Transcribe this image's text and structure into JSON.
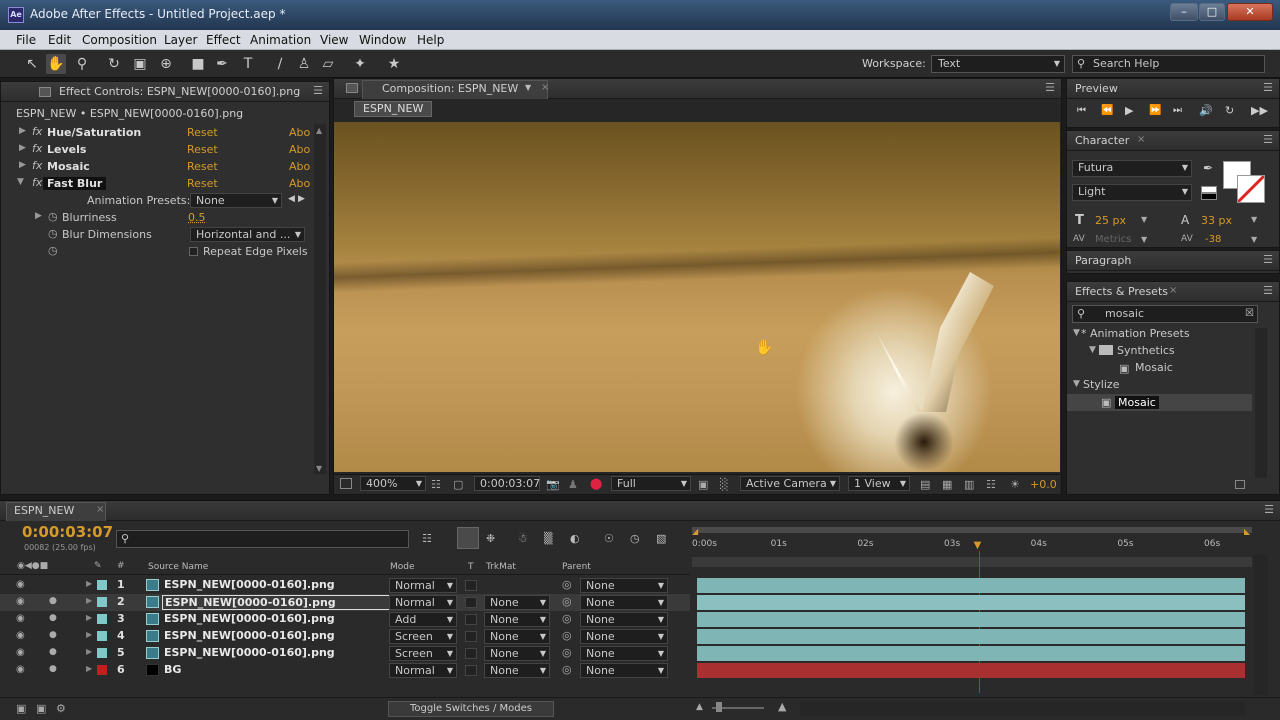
{
  "window": {
    "title": "Adobe After Effects - Untitled Project.aep *",
    "app_icon": "Ae"
  },
  "menu": [
    "File",
    "Edit",
    "Composition",
    "Layer",
    "Effect",
    "Animation",
    "View",
    "Window",
    "Help"
  ],
  "toolbar": {
    "workspace_label": "Workspace:",
    "workspace_value": "Text",
    "search_placeholder": "Search Help"
  },
  "effect_controls": {
    "tab": "Effect Controls: ESPN_NEW[0000-0160].png",
    "breadcrumb": "ESPN_NEW • ESPN_NEW[0000-0160].png",
    "effects": [
      {
        "name": "Hue/Saturation",
        "reset": "Reset",
        "about": "Abo"
      },
      {
        "name": "Levels",
        "reset": "Reset",
        "about": "Abo"
      },
      {
        "name": "Mosaic",
        "reset": "Reset",
        "about": "Abo"
      },
      {
        "name": "Fast Blur",
        "reset": "Reset",
        "about": "Abo"
      }
    ],
    "animation_presets_label": "Animation Presets:",
    "animation_presets_value": "None",
    "blurriness_label": "Blurriness",
    "blurriness_value": "0.5",
    "blur_dimensions_label": "Blur Dimensions",
    "blur_dimensions_value": "Horizontal and ...",
    "repeat_edge_label": "Repeat Edge Pixels"
  },
  "composition": {
    "tab": "Composition: ESPN_NEW",
    "comp_name": "ESPN_NEW",
    "zoom": "400%",
    "timecode": "0:00:03:07",
    "resolution": "Full",
    "camera": "Active Camera",
    "views": "1 View",
    "exposure": "+0.0"
  },
  "preview": {
    "tab": "Preview"
  },
  "character": {
    "tab": "Character",
    "font": "Futura",
    "style": "Light",
    "size": "25 px",
    "leading": "33 px",
    "kerning": "Metrics",
    "tracking": "-38"
  },
  "paragraph": {
    "tab": "Paragraph"
  },
  "effects_presets": {
    "tab": "Effects & Presets",
    "search_value": "mosaic",
    "tree": [
      {
        "label": "* Animation Presets",
        "level": 0
      },
      {
        "label": "Synthetics",
        "level": 1
      },
      {
        "label": "Mosaic",
        "level": 2
      },
      {
        "label": "Stylize",
        "level": 0
      },
      {
        "label": "Mosaic",
        "level": 1
      }
    ]
  },
  "timeline": {
    "tab": "ESPN_NEW",
    "timecode": "0:00:03:07",
    "frame_info": "00082 (25.00 fps)",
    "columns": {
      "source_name": "Source Name",
      "mode": "Mode",
      "t": "T",
      "trkmat": "TrkMat",
      "parent": "Parent"
    },
    "ruler": [
      "0:00s",
      "01s",
      "02s",
      "03s",
      "04s",
      "05s",
      "06s"
    ],
    "playhead_fraction": 0.514,
    "layers": [
      {
        "num": "1",
        "name": "ESPN_NEW[0000-0160].png",
        "mode": "Normal",
        "trkmat": "",
        "parent": "None",
        "color": "#7fc9c9",
        "bar": "#7fb5b5"
      },
      {
        "num": "2",
        "name": "ESPN_NEW[0000-0160].png",
        "mode": "Normal",
        "trkmat": "None",
        "parent": "None",
        "color": "#7fc9c9",
        "bar": "#8cc0c0"
      },
      {
        "num": "3",
        "name": "ESPN_NEW[0000-0160].png",
        "mode": "Add",
        "trkmat": "None",
        "parent": "None",
        "color": "#7fc9c9",
        "bar": "#7fb5b5"
      },
      {
        "num": "4",
        "name": "ESPN_NEW[0000-0160].png",
        "mode": "Screen",
        "trkmat": "None",
        "parent": "None",
        "color": "#7fc9c9",
        "bar": "#7fb5b5"
      },
      {
        "num": "5",
        "name": "ESPN_NEW[0000-0160].png",
        "mode": "Screen",
        "trkmat": "None",
        "parent": "None",
        "color": "#7fc9c9",
        "bar": "#7fb5b5"
      },
      {
        "num": "6",
        "name": "BG",
        "mode": "Normal",
        "trkmat": "None",
        "parent": "None",
        "color": "#c02020",
        "bar": "#a83030"
      }
    ],
    "toggle_label": "Toggle Switches / Modes"
  }
}
